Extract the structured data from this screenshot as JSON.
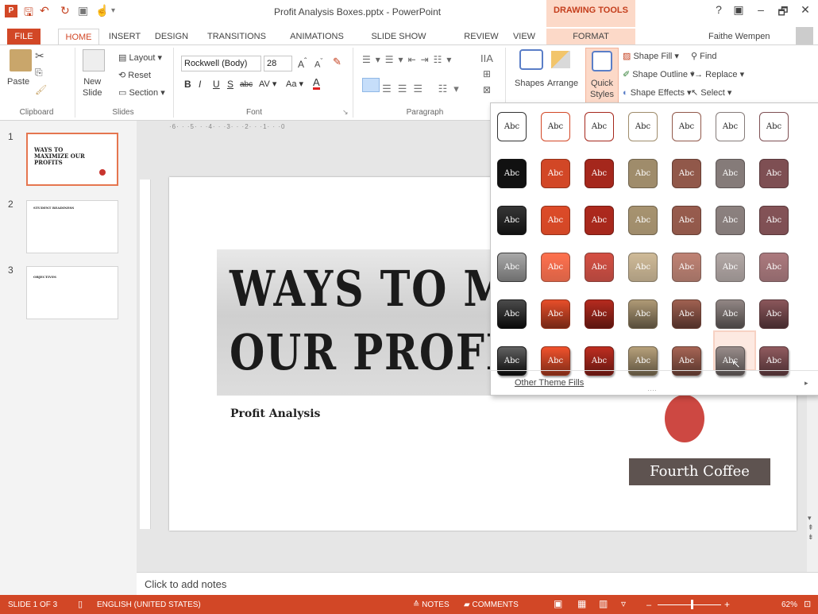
{
  "app": {
    "doc_title": "Profit Analysis Boxes.pptx - PowerPoint",
    "contextual_tab_group": "DRAWING TOOLS",
    "user_name": "Faithe Wempen",
    "window_buttons": [
      "?",
      "▣",
      "–",
      "🗗",
      "✕"
    ]
  },
  "tabs": [
    "FILE",
    "HOME",
    "INSERT",
    "DESIGN",
    "TRANSITIONS",
    "ANIMATIONS",
    "SLIDE SHOW",
    "REVIEW",
    "VIEW",
    "FORMAT"
  ],
  "ribbon": {
    "clipboard": {
      "paste": "Paste",
      "label": "Clipboard"
    },
    "slides": {
      "new_slide": "New\nSlide",
      "layout": "Layout",
      "reset": "Reset",
      "section": "Section",
      "label": "Slides"
    },
    "font": {
      "font_name": "Rockwell (Body)",
      "font_size": "28",
      "label": "Font"
    },
    "paragraph": {
      "label": "Paragraph"
    },
    "drawing": {
      "shapes": "Shapes",
      "arrange": "Arrange",
      "quick_styles": "Quick\nStyles",
      "shape_fill": "Shape Fill",
      "shape_outline": "Shape Outline",
      "shape_effects": "Shape Effects"
    },
    "editing": {
      "find": "Find",
      "replace": "Replace",
      "select": "Select"
    }
  },
  "thumbnails": [
    {
      "num": "1",
      "title": "WAYS TO MAXIMIZE OUR PROFITS"
    },
    {
      "num": "2",
      "title": "STUDENT READINESS"
    },
    {
      "num": "3",
      "title": "OBJECTIVES"
    }
  ],
  "slide": {
    "banner_line1": "WAYS TO MA",
    "banner_line2": "OUR PROFITS",
    "subtitle": "Profit Analysis",
    "company": "Fourth Coffee"
  },
  "ruler_text": "·6· · ·5· · ·4· · ·3· · ·2· · ·1· · ·0",
  "notes_placeholder": "Click to add notes",
  "gallery": {
    "swatch_label": "Abc",
    "other_fills": "Other Theme Fills",
    "colors": [
      "#ffffff",
      "#d24726",
      "#a5271c",
      "#9f8c6b",
      "#91584a",
      "#857b79",
      "#7e4f53"
    ],
    "hover_row": 5,
    "hover_col": 5
  },
  "status": {
    "slide": "SLIDE 1 OF 3",
    "language": "ENGLISH (UNITED STATES)",
    "notes": "NOTES",
    "comments": "COMMENTS",
    "zoom": "62%"
  }
}
